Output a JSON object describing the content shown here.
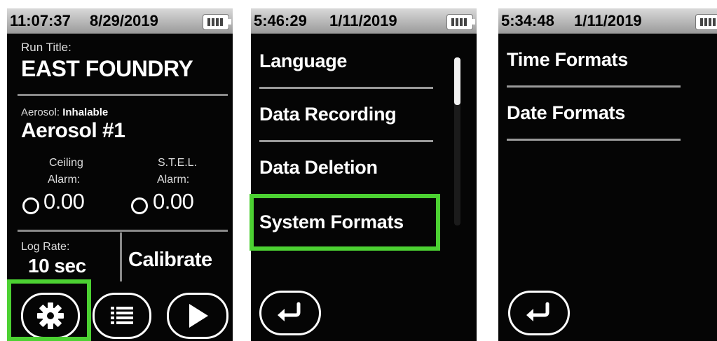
{
  "screen1": {
    "status": {
      "time": "11:07:37",
      "date": "8/29/2019"
    },
    "run_title_label": "Run Title:",
    "run_title": "EAST FOUNDRY",
    "aerosol_label": "Aerosol:",
    "aerosol_type": "Inhalable",
    "aerosol_name": "Aerosol #1",
    "ceiling_label": "Ceiling",
    "ceiling_alarm_label": "Alarm:",
    "ceiling_alarm_value": "0.00",
    "stel_label": "S.T.E.L.",
    "stel_alarm_label": "Alarm:",
    "stel_alarm_value": "0.00",
    "log_rate_label": "Log Rate:",
    "log_rate_value": "10 sec",
    "calibrate_label": "Calibrate",
    "buttons": [
      "gear-icon",
      "list-icon",
      "play-icon"
    ]
  },
  "screen2": {
    "status": {
      "time": "5:46:29",
      "date": "1/11/2019"
    },
    "menu": [
      "Language",
      "Data Recording",
      "Data Deletion",
      "System Formats"
    ],
    "highlighted": "System Formats",
    "back_icon": "return-arrow-icon"
  },
  "screen3": {
    "status": {
      "time": "5:34:48",
      "date": "1/11/2019"
    },
    "menu": [
      "Time Formats",
      "Date Formats"
    ],
    "back_icon": "return-arrow-icon"
  },
  "colors": {
    "highlight": "#4cd132",
    "background": "#050505",
    "statusbar": "#bdbdbd"
  }
}
